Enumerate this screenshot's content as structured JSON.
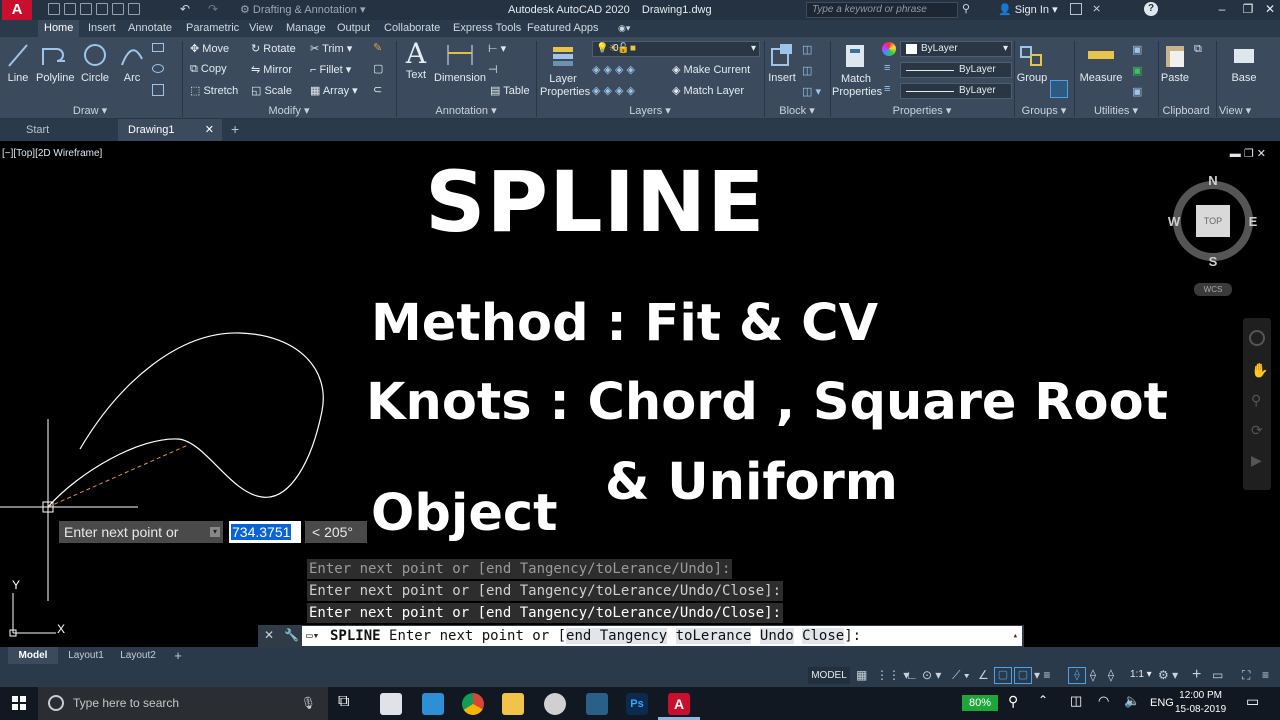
{
  "app": {
    "logo": "A",
    "workspace": "Drafting & Annotation",
    "title": "Autodesk AutoCAD 2020    Drawing1.dwg",
    "search_placeholder": "Type a keyword or phrase",
    "sign_in": "Sign In"
  },
  "ribbon": {
    "tabs": [
      "Home",
      "Insert",
      "Annotate",
      "Parametric",
      "View",
      "Manage",
      "Output",
      "Collaborate",
      "Express Tools",
      "Featured Apps"
    ],
    "draw": {
      "line": "Line",
      "polyline": "Polyline",
      "circle": "Circle",
      "arc": "Arc",
      "title": "Draw"
    },
    "modify": {
      "move": "Move",
      "rotate": "Rotate",
      "trim": "Trim",
      "copy": "Copy",
      "mirror": "Mirror",
      "fillet": "Fillet",
      "stretch": "Stretch",
      "scale": "Scale",
      "array": "Array",
      "title": "Modify"
    },
    "annotation": {
      "text": "Text",
      "dimension": "Dimension",
      "table": "Table",
      "title": "Annotation"
    },
    "layers": {
      "props": "Layer Properties",
      "current": "0",
      "make_current": "Make Current",
      "match_layer": "Match Layer",
      "title": "Layers"
    },
    "block": {
      "insert": "Insert",
      "title": "Block"
    },
    "properties": {
      "match": "Match Properties",
      "bylayer1": "ByLayer",
      "bylayer2": "ByLayer",
      "bylayer3": "ByLayer",
      "title": "Properties"
    },
    "groups": {
      "group": "Group",
      "title": "Groups"
    },
    "utilities": {
      "measure": "Measure",
      "title": "Utilities"
    },
    "clipboard": {
      "paste": "Paste",
      "title": "Clipboard"
    },
    "view": {
      "base": "Base",
      "title": "View"
    }
  },
  "filetabs": {
    "start": "Start",
    "drawing": "Drawing1"
  },
  "viewport": {
    "controls": "[−][Top][2D Wireframe]",
    "compass": {
      "n": "N",
      "s": "S",
      "e": "E",
      "w": "W",
      "top": "TOP",
      "wcs": "WCS"
    },
    "ucs": {
      "x": "X",
      "y": "Y"
    }
  },
  "overlay": {
    "title": "SPLINE",
    "method": "Method : Fit & CV",
    "knots": "Knots : Chord , Square Root",
    "uniform": "& Uniform",
    "object": "Object"
  },
  "dynamic_input": {
    "prompt": "Enter next point or",
    "value": "734.3751",
    "angle": "< 205°"
  },
  "history": [
    "Enter next point or [end Tangency/toLerance/Undo]:",
    "Enter next point or [end Tangency/toLerance/Undo/Close]:",
    "Enter next point or [end Tangency/toLerance/Undo/Close]:"
  ],
  "command": {
    "name": "SPLINE",
    "prompt": "Enter next point or [",
    "opt1": "end Tangency",
    "opt2": "toLerance",
    "opt3": "Undo",
    "opt4": "Close",
    "end": "]:"
  },
  "layouts": [
    "Model",
    "Layout1",
    "Layout2"
  ],
  "status": {
    "model": "MODEL",
    "scale": "1:1"
  },
  "taskbar": {
    "search": "Type here to search",
    "battery": "80%",
    "lang": "ENG",
    "time": "12:00 PM",
    "date": "15-08-2019"
  },
  "colors": {
    "accent": "#c8102e",
    "ribbon": "#3b4b5d",
    "highlight": "#0a63d4",
    "battery": "#1fa63a"
  }
}
